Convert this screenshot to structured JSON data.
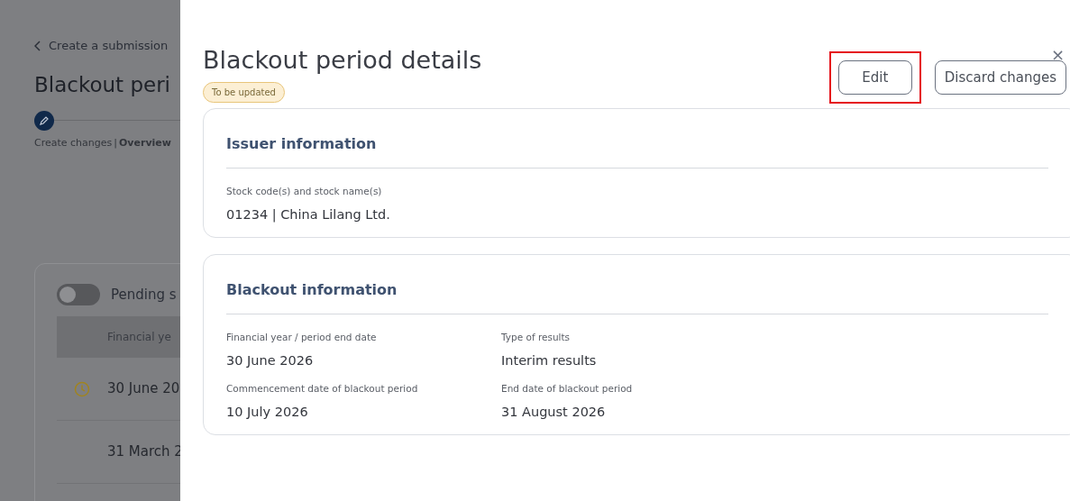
{
  "background_page": {
    "back_link": "Create a submission",
    "title": "Blackout peri",
    "step_label": "Create changes",
    "step_separator": "|",
    "step_current": "Overview",
    "toggle": {
      "label": "Pending s",
      "on": false
    },
    "table_header": "Financial ye",
    "rows": [
      {
        "text": "30 June 20",
        "pending": true
      },
      {
        "text": "31 March 2",
        "pending": false
      }
    ]
  },
  "drawer": {
    "title": "Blackout period details",
    "close": "×",
    "status_badge": "To be updated",
    "buttons": [
      {
        "label": "Edit",
        "highlighted": true
      },
      {
        "label": "Discard changes",
        "highlighted": false
      }
    ],
    "sections": [
      {
        "heading": "Issuer information",
        "fields": [
          {
            "label": "Stock code(s) and stock name(s)",
            "value": "01234 | China Lilang Ltd."
          }
        ]
      },
      {
        "heading": "Blackout information",
        "fields": [
          {
            "label": "Financial year / period end date",
            "value": "30 June 2026"
          },
          {
            "label": "Type of results",
            "value": "Interim results"
          },
          {
            "label": "Commencement date of blackout period",
            "value": "10 July 2026"
          },
          {
            "label": "End date of blackout period",
            "value": "31 August 2026"
          }
        ]
      }
    ]
  }
}
